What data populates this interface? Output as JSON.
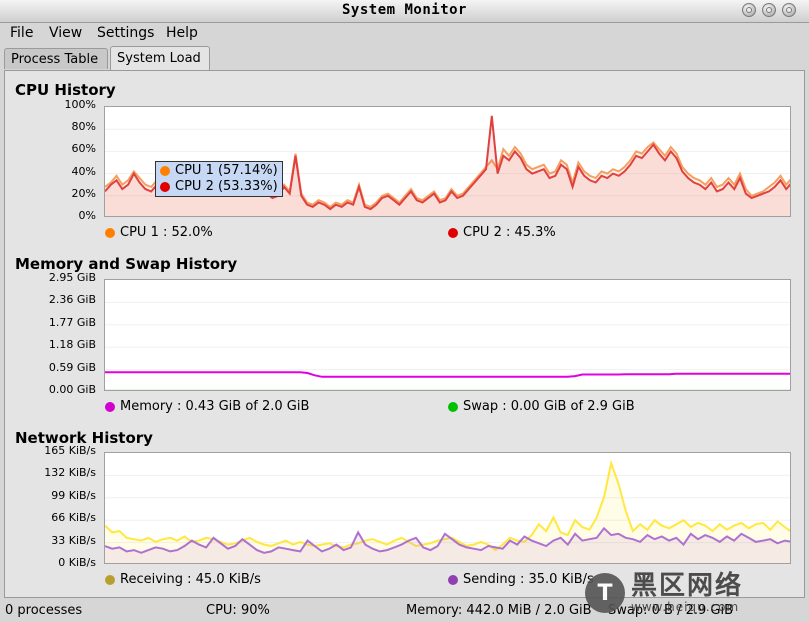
{
  "window": {
    "title": "System Monitor"
  },
  "menu": [
    "File",
    "View",
    "Settings",
    "Help"
  ],
  "tabs": [
    {
      "label": "Process Table",
      "active": false
    },
    {
      "label": "System Load",
      "active": true
    }
  ],
  "cpu": {
    "title": "CPU History",
    "yticks": [
      "100%",
      "80%",
      "60%",
      "40%",
      "20%",
      "0%"
    ],
    "legend": [
      {
        "label": "CPU 1 : 52.0%",
        "color": "#ff8000"
      },
      {
        "label": "CPU 2 : 45.3%",
        "color": "#e00000"
      }
    ],
    "tooltip": [
      {
        "label": "CPU 1 (57.14%)",
        "color": "#ff8000"
      },
      {
        "label": "CPU 2 (53.33%)",
        "color": "#e00000"
      }
    ]
  },
  "memory": {
    "title": "Memory and Swap History",
    "yticks": [
      "2.95 GiB",
      "2.36 GiB",
      "1.77 GiB",
      "1.18 GiB",
      "0.59 GiB",
      "0.00 GiB"
    ],
    "legend": [
      {
        "label": "Memory : 0.43 GiB of 2.0 GiB",
        "color": "#d000d0"
      },
      {
        "label": "Swap : 0.00 GiB of 2.9 GiB",
        "color": "#00c000"
      }
    ]
  },
  "network": {
    "title": "Network History",
    "yticks": [
      "165 KiB/s",
      "132 KiB/s",
      "99 KiB/s",
      "66 KiB/s",
      "33 KiB/s",
      "0 KiB/s"
    ],
    "legend": [
      {
        "label": "Receiving : 45.0 KiB/s",
        "color": "#b8a030"
      },
      {
        "label": "Sending : 35.0 KiB/s",
        "color": "#9040b0"
      }
    ]
  },
  "status": {
    "processes": "0 processes",
    "cpu": "CPU: 90%",
    "memory": "Memory: 442.0 MiB / 2.0 GiB",
    "swap": "Swap: 0 B / 2.9 GiB"
  },
  "watermark": {
    "main": "黑区网络",
    "sub": "www.heiqu.com",
    "badge": "T"
  },
  "chart_data": [
    {
      "type": "area",
      "title": "CPU History",
      "ylim": [
        0,
        100
      ],
      "series": [
        {
          "name": "CPU 1",
          "color": "#f4a060",
          "values": [
            28,
            32,
            38,
            30,
            34,
            42,
            36,
            30,
            28,
            34,
            30,
            28,
            32,
            30,
            38,
            34,
            30,
            28,
            30,
            36,
            32,
            30,
            28,
            24,
            22,
            28,
            30,
            26,
            24,
            20,
            22,
            30,
            24,
            58,
            22,
            14,
            12,
            16,
            14,
            10,
            14,
            12,
            16,
            14,
            30,
            12,
            10,
            14,
            20,
            22,
            18,
            14,
            20,
            26,
            18,
            16,
            20,
            24,
            16,
            18,
            26,
            20,
            22,
            28,
            34,
            40,
            46,
            52,
            44,
            62,
            56,
            64,
            58,
            48,
            44,
            46,
            48,
            40,
            42,
            52,
            48,
            32,
            50,
            42,
            38,
            36,
            42,
            40,
            44,
            42,
            46,
            52,
            60,
            58,
            64,
            68,
            62,
            56,
            64,
            58,
            46,
            40,
            36,
            34,
            30,
            36,
            28,
            30,
            36,
            30,
            40,
            26,
            20,
            22,
            24,
            28,
            32,
            38,
            30,
            36
          ]
        },
        {
          "name": "CPU 2",
          "color": "#e04040",
          "values": [
            24,
            30,
            34,
            26,
            30,
            40,
            32,
            26,
            24,
            30,
            26,
            24,
            28,
            26,
            34,
            30,
            26,
            24,
            26,
            32,
            28,
            26,
            24,
            22,
            20,
            24,
            28,
            24,
            22,
            18,
            20,
            28,
            22,
            56,
            20,
            12,
            10,
            14,
            12,
            8,
            12,
            10,
            14,
            12,
            28,
            10,
            8,
            12,
            18,
            20,
            16,
            12,
            18,
            24,
            16,
            14,
            18,
            22,
            14,
            16,
            24,
            18,
            20,
            26,
            32,
            38,
            44,
            92,
            40,
            56,
            52,
            60,
            54,
            44,
            40,
            42,
            44,
            36,
            38,
            48,
            44,
            28,
            46,
            38,
            34,
            32,
            38,
            36,
            40,
            38,
            42,
            48,
            56,
            54,
            60,
            66,
            58,
            52,
            60,
            54,
            42,
            36,
            32,
            30,
            26,
            32,
            24,
            26,
            32,
            26,
            36,
            22,
            18,
            20,
            22,
            24,
            28,
            34,
            26,
            32
          ]
        }
      ]
    },
    {
      "type": "line",
      "title": "Memory and Swap History",
      "ylim": [
        0,
        2.95
      ],
      "series": [
        {
          "name": "Memory",
          "color": "#e000e0",
          "values": [
            0.52,
            0.52,
            0.52,
            0.52,
            0.52,
            0.52,
            0.52,
            0.52,
            0.52,
            0.52,
            0.52,
            0.52,
            0.52,
            0.52,
            0.52,
            0.52,
            0.52,
            0.52,
            0.52,
            0.52,
            0.52,
            0.52,
            0.52,
            0.52,
            0.52,
            0.52,
            0.52,
            0.52,
            0.5,
            0.44,
            0.4,
            0.4,
            0.4,
            0.4,
            0.4,
            0.4,
            0.4,
            0.4,
            0.4,
            0.4,
            0.4,
            0.4,
            0.4,
            0.4,
            0.4,
            0.4,
            0.4,
            0.4,
            0.4,
            0.4,
            0.4,
            0.4,
            0.4,
            0.4,
            0.4,
            0.4,
            0.4,
            0.4,
            0.4,
            0.4,
            0.4,
            0.4,
            0.4,
            0.4,
            0.4,
            0.42,
            0.46,
            0.46,
            0.46,
            0.46,
            0.46,
            0.46,
            0.47,
            0.47,
            0.47,
            0.47,
            0.47,
            0.47,
            0.47,
            0.48,
            0.48,
            0.48,
            0.48,
            0.48,
            0.48,
            0.48,
            0.48,
            0.48,
            0.48,
            0.48,
            0.48,
            0.48,
            0.48,
            0.48,
            0.48,
            0.48
          ]
        },
        {
          "name": "Swap",
          "color": "#00c000",
          "values": [
            0.03,
            0.03,
            0.03,
            0.03,
            0.03,
            0.03,
            0.03,
            0.03,
            0.03,
            0.03,
            0.03,
            0.03,
            0.03,
            0.03,
            0.03,
            0.03,
            0.03,
            0.03,
            0.03,
            0.03,
            0.03,
            0.03,
            0.03,
            0.03,
            0.03,
            0.03,
            0.03,
            0.03,
            0.03,
            0.03,
            0.03,
            0.03,
            0.03,
            0.03,
            0.03,
            0.03,
            0.03,
            0.03,
            0.03,
            0.03,
            0.03,
            0.03,
            0.03,
            0.03,
            0.03,
            0.03,
            0.03,
            0.03,
            0.03,
            0.03,
            0.03,
            0.03,
            0.03,
            0.03,
            0.03,
            0.03,
            0.03,
            0.03,
            0.03,
            0.03,
            0.03,
            0.03,
            0.03,
            0.03,
            0.03,
            0.03,
            0.03,
            0.03,
            0.03,
            0.03,
            0.03,
            0.03,
            0.03,
            0.03,
            0.03,
            0.03,
            0.03,
            0.03,
            0.03,
            0.03,
            0.03,
            0.03,
            0.03,
            0.03,
            0.03,
            0.03,
            0.03,
            0.03,
            0.03,
            0.03,
            0.03,
            0.03,
            0.03,
            0.03,
            0.03,
            0.03
          ]
        }
      ]
    },
    {
      "type": "area",
      "title": "Network History",
      "ylim": [
        0,
        165
      ],
      "series": [
        {
          "name": "Receiving",
          "color": "#ffe840",
          "values": [
            58,
            48,
            50,
            40,
            38,
            36,
            40,
            34,
            38,
            40,
            36,
            42,
            34,
            36,
            40,
            38,
            34,
            30,
            32,
            36,
            40,
            34,
            30,
            28,
            32,
            36,
            30,
            34,
            30,
            28,
            30,
            32,
            28,
            26,
            30,
            32,
            36,
            38,
            34,
            30,
            36,
            40,
            34,
            28,
            30,
            32,
            36,
            38,
            40,
            34,
            28,
            30,
            34,
            30,
            22,
            30,
            40,
            36,
            34,
            44,
            60,
            50,
            70,
            48,
            44,
            66,
            56,
            52,
            70,
            100,
            150,
            120,
            80,
            50,
            60,
            52,
            66,
            58,
            54,
            60,
            66,
            56,
            62,
            58,
            50,
            60,
            52,
            58,
            62,
            54,
            60,
            62,
            52,
            64,
            56,
            48
          ]
        },
        {
          "name": "Sending",
          "color": "#b070d0",
          "values": [
            28,
            24,
            26,
            20,
            22,
            18,
            22,
            26,
            24,
            20,
            22,
            28,
            36,
            30,
            26,
            40,
            32,
            24,
            28,
            38,
            30,
            22,
            18,
            20,
            26,
            24,
            22,
            20,
            36,
            28,
            20,
            24,
            30,
            22,
            26,
            48,
            30,
            24,
            20,
            22,
            26,
            30,
            36,
            40,
            26,
            22,
            28,
            46,
            38,
            30,
            26,
            24,
            22,
            28,
            26,
            24,
            36,
            30,
            42,
            36,
            32,
            28,
            36,
            40,
            30,
            46,
            36,
            38,
            40,
            54,
            44,
            46,
            40,
            38,
            34,
            44,
            38,
            42,
            36,
            40,
            30,
            46,
            38,
            44,
            40,
            34,
            42,
            36,
            46,
            40,
            34,
            36,
            38,
            32,
            36,
            34
          ]
        }
      ]
    }
  ]
}
